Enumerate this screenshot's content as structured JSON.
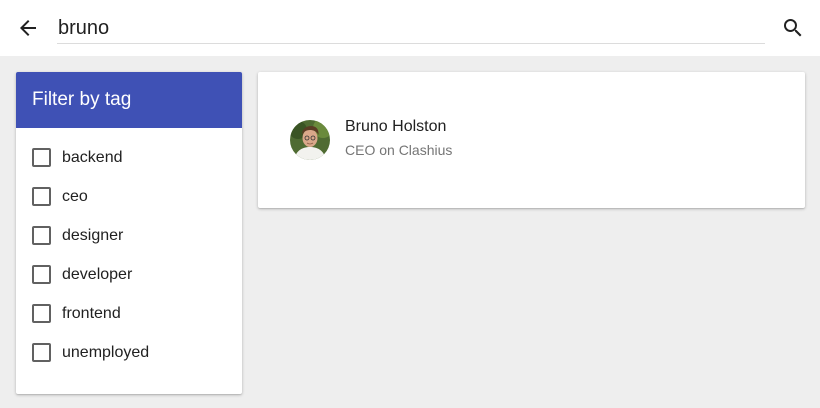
{
  "topbar": {
    "back_icon": "arrow-left-icon",
    "search_value": "bruno",
    "search_icon": "search-icon"
  },
  "filter": {
    "title": "Filter by tag",
    "header_color": "#3f51b5",
    "tags": [
      {
        "label": "backend",
        "checked": false
      },
      {
        "label": "ceo",
        "checked": false
      },
      {
        "label": "designer",
        "checked": false
      },
      {
        "label": "developer",
        "checked": false
      },
      {
        "label": "frontend",
        "checked": false
      },
      {
        "label": "unemployed",
        "checked": false
      }
    ]
  },
  "results": [
    {
      "name": "Bruno Holston",
      "role": "CEO on Clashius",
      "avatar_icon": "avatar-photo"
    }
  ]
}
